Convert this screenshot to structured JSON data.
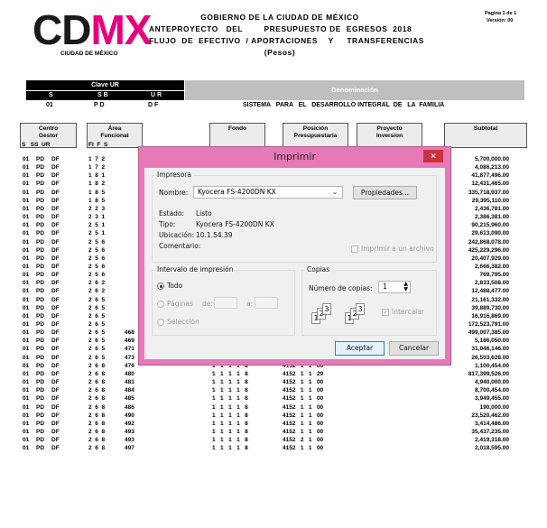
{
  "header": {
    "logo_main": "CD",
    "logo_accent": "MX",
    "logo_sub": "CIUDAD DE MÉXICO",
    "gov_line1": "GOBIERNO  DE  LA  CIUDAD  DE  MÉXICO",
    "gov_line2": "ANTEPROYECTO   DEL        PRESUPUESTO DE  EGRESOS  2018",
    "gov_line3": "FLUJO  DE  EFECTIVO  / APORTACIONES    Y     TRANSFERENCIAS",
    "gov_line4": "(Pesos)",
    "page_label": "Pagina  1  de 1",
    "version_label": "Versión:  00"
  },
  "clave": {
    "title": "Clave  UR",
    "col_s": "S",
    "col_sb": "S B",
    "col_ur": "U R",
    "val_s": "01",
    "val_sb": "P D",
    "val_ur": "D F",
    "denominacion_label": "Denominación",
    "denominacion_value": "SISTEMA   PARA   EL   DESARROLLO INTEGRAL  DE   LA  FAMILIA"
  },
  "columns": {
    "centro": "Centro\nGestor",
    "centro_sub": "S   SS  UR",
    "area": "Área\nFuncional",
    "area_sub": "FI  F  S",
    "fondo": "Fondo",
    "posicion": "Posición\nPresupuestaria",
    "proyecto": "Proyecto\nInversion",
    "subtotal": "Subtotal"
  },
  "rows": [
    {
      "s": "01",
      "ss": "PD",
      "ur": "DF",
      "area": "1  7  2",
      "pp": "",
      "fondo": "",
      "pos": "",
      "amt": "5,700,000.00"
    },
    {
      "s": "01",
      "ss": "PD",
      "ur": "DF",
      "area": "1  7  2",
      "pp": "",
      "fondo": "",
      "pos": "",
      "amt": "4,086,213.00"
    },
    {
      "s": "01",
      "ss": "PD",
      "ur": "DF",
      "area": "1  8  1",
      "pp": "",
      "fondo": "",
      "pos": "",
      "amt": "41,877,496.00"
    },
    {
      "s": "01",
      "ss": "PD",
      "ur": "DF",
      "area": "1  8  2",
      "pp": "",
      "fondo": "",
      "pos": "",
      "amt": "12,431,465.00"
    },
    {
      "s": "01",
      "ss": "PD",
      "ur": "DF",
      "area": "1  8  5",
      "pp": "",
      "fondo": "",
      "pos": "",
      "amt": "335,718,937.00"
    },
    {
      "s": "01",
      "ss": "PD",
      "ur": "DF",
      "area": "1  8  5",
      "pp": "",
      "fondo": "",
      "pos": "",
      "amt": "29,395,110.00"
    },
    {
      "s": "01",
      "ss": "PD",
      "ur": "DF",
      "area": "2  2  3",
      "pp": "",
      "fondo": "",
      "pos": "",
      "amt": "2,436,781.00"
    },
    {
      "s": "01",
      "ss": "PD",
      "ur": "DF",
      "area": "2  3  1",
      "pp": "",
      "fondo": "",
      "pos": "",
      "amt": "2,386,381.00"
    },
    {
      "s": "01",
      "ss": "PD",
      "ur": "DF",
      "area": "2  5  1",
      "pp": "",
      "fondo": "",
      "pos": "",
      "amt": "90,215,960.00"
    },
    {
      "s": "01",
      "ss": "PD",
      "ur": "DF",
      "area": "2  5  1",
      "pp": "",
      "fondo": "",
      "pos": "",
      "amt": "29,613,090.00"
    },
    {
      "s": "01",
      "ss": "PD",
      "ur": "DF",
      "area": "2  5  6",
      "pp": "",
      "fondo": "",
      "pos": "",
      "amt": "242,868,078.00"
    },
    {
      "s": "01",
      "ss": "PD",
      "ur": "DF",
      "area": "2  5  6",
      "pp": "",
      "fondo": "",
      "pos": "",
      "amt": "425,229,296.00"
    },
    {
      "s": "01",
      "ss": "PD",
      "ur": "DF",
      "area": "2  5  6",
      "pp": "",
      "fondo": "",
      "pos": "",
      "amt": "20,407,929.00"
    },
    {
      "s": "01",
      "ss": "PD",
      "ur": "DF",
      "area": "2  5  6",
      "pp": "",
      "fondo": "",
      "pos": "",
      "amt": "2,666,382.00"
    },
    {
      "s": "01",
      "ss": "PD",
      "ur": "DF",
      "area": "2  5  6",
      "pp": "",
      "fondo": "",
      "pos": "",
      "amt": "769,795.00"
    },
    {
      "s": "01",
      "ss": "PD",
      "ur": "DF",
      "area": "2  6  2",
      "pp": "",
      "fondo": "",
      "pos": "",
      "amt": "2,833,508.00"
    },
    {
      "s": "01",
      "ss": "PD",
      "ur": "DF",
      "area": "2  6  2",
      "pp": "",
      "fondo": "",
      "pos": "",
      "amt": "12,488,477.00"
    },
    {
      "s": "01",
      "ss": "PD",
      "ur": "DF",
      "area": "2  6  5",
      "pp": "",
      "fondo": "",
      "pos": "",
      "amt": "21,161,332.00"
    },
    {
      "s": "01",
      "ss": "PD",
      "ur": "DF",
      "area": "2  6  5",
      "pp": "",
      "fondo": "",
      "pos": "",
      "amt": "39,889,730.00"
    },
    {
      "s": "01",
      "ss": "PD",
      "ur": "DF",
      "area": "2  6  5",
      "pp": "",
      "fondo": "",
      "pos": "",
      "amt": "16,916,869.00"
    },
    {
      "s": "01",
      "ss": "PD",
      "ur": "DF",
      "area": "2  6  5",
      "pp": "",
      "fondo": "",
      "pos": "",
      "amt": "172,523,791.00"
    },
    {
      "s": "01",
      "ss": "PD",
      "ur": "DF",
      "area": "2  6  5",
      "pp": "468",
      "fondo": "2   5   P   3   8",
      "pos": "4151   1   1   29",
      "amt": "499,007,385.00"
    },
    {
      "s": "01",
      "ss": "PD",
      "ur": "DF",
      "area": "2  6  5",
      "pp": "469",
      "fondo": "1   1   1   1   8",
      "pos": "4152   1   1   00",
      "amt": "5,186,050.00"
    },
    {
      "s": "01",
      "ss": "PD",
      "ur": "DF",
      "area": "2  6  5",
      "pp": "471",
      "fondo": "1   1   1   1   8",
      "pos": "4152   1   1   00",
      "amt": "31,046,146.00"
    },
    {
      "s": "01",
      "ss": "PD",
      "ur": "DF",
      "area": "2  6  5",
      "pp": "473",
      "fondo": "1   1   1   1   8",
      "pos": "4152   1   1   00",
      "amt": "26,503,628.00"
    },
    {
      "s": "01",
      "ss": "PD",
      "ur": "DF",
      "area": "2  6  8",
      "pp": "476",
      "fondo": "1   1   1   1   8",
      "pos": "4152   1   1   00",
      "amt": "1,100,454.00"
    },
    {
      "s": "01",
      "ss": "PD",
      "ur": "DF",
      "area": "2  6  8",
      "pp": "480",
      "fondo": "1   1   1   1   8",
      "pos": "4152   1   1   29",
      "amt": "817,399,526.00"
    },
    {
      "s": "01",
      "ss": "PD",
      "ur": "DF",
      "area": "2  6  8",
      "pp": "481",
      "fondo": "1   1   1   1   8",
      "pos": "4152   1   1   00",
      "amt": "4,940,000.00"
    },
    {
      "s": "01",
      "ss": "PD",
      "ur": "DF",
      "area": "2  6  8",
      "pp": "484",
      "fondo": "1   1   1   1   8",
      "pos": "4152   1   1   00",
      "amt": "8,700,454.00"
    },
    {
      "s": "01",
      "ss": "PD",
      "ur": "DF",
      "area": "2  6  8",
      "pp": "485",
      "fondo": "1   1   1   1   8",
      "pos": "4152   1   1   00",
      "amt": "3,949,455.00"
    },
    {
      "s": "01",
      "ss": "PD",
      "ur": "DF",
      "area": "2  6  8",
      "pp": "486",
      "fondo": "1   1   1   1   8",
      "pos": "4152   1   1   00",
      "amt": "190,000.00"
    },
    {
      "s": "01",
      "ss": "PD",
      "ur": "DF",
      "area": "2  6  8",
      "pp": "490",
      "fondo": "1   1   1   1   8",
      "pos": "4152   1   1   00",
      "amt": "23,520,462.00"
    },
    {
      "s": "01",
      "ss": "PD",
      "ur": "DF",
      "area": "2  6  8",
      "pp": "492",
      "fondo": "1   1   1   1   8",
      "pos": "4152   1   1   00",
      "amt": "3,414,486.00"
    },
    {
      "s": "01",
      "ss": "PD",
      "ur": "DF",
      "area": "2  6  8",
      "pp": "493",
      "fondo": "1   1   1   1   8",
      "pos": "4152   1   1   00",
      "amt": "35,437,235.00"
    },
    {
      "s": "01",
      "ss": "PD",
      "ur": "DF",
      "area": "2  6  8",
      "pp": "493",
      "fondo": "1   1   1   1   8",
      "pos": "4152   2   1   00",
      "amt": "2,419,318.00"
    },
    {
      "s": "01",
      "ss": "PD",
      "ur": "DF",
      "area": "2  6  8",
      "pp": "497",
      "fondo": "1   1   1   1   8",
      "pos": "4152   1   1   00",
      "amt": "2,018,595.00"
    }
  ],
  "dialog": {
    "title": "Imprimir",
    "close_glyph": "✕",
    "printer_group": "Impresora",
    "name_label": "Nombre:",
    "printer_name": "Kyocera FS-4200DN KX",
    "properties_button": "Propiedades...",
    "status_label": "Estado:",
    "status_value": "Listo",
    "type_label": "Tipo:",
    "type_value": "Kyocera FS-4200DN KX",
    "location_label": "Ubicación:",
    "location_value": "10.1.54.39",
    "comment_label": "Comentario:",
    "print_to_file_label": "Imprimir a un archivo",
    "range_group": "Intervalo de impresión",
    "range_all": "Todo",
    "range_pages": "Páginas",
    "range_from": "de:",
    "range_to": "a:",
    "range_selection": "Selección",
    "copies_group": "Copias",
    "copies_label": "Número de copias:",
    "copies_value": "1",
    "collate_label": "Intercalar",
    "accept_button": "Aceptar",
    "cancel_button": "Cancelar"
  },
  "colors": {
    "accent_magenta": "#e6007e",
    "dialog_frame": "#e879b7",
    "close_red": "#c7333c"
  }
}
